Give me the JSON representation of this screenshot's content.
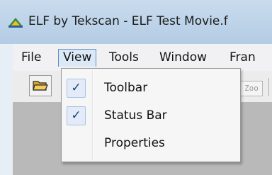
{
  "window": {
    "title": "ELF by Tekscan - ELF Test Movie.f"
  },
  "menubar": {
    "items": [
      {
        "label": "File"
      },
      {
        "label": "View"
      },
      {
        "label": "Tools"
      },
      {
        "label": "Window"
      },
      {
        "label": "Fran"
      }
    ]
  },
  "toolbar": {
    "zoom_label": "Zoo"
  },
  "view_menu": {
    "items": [
      {
        "label": "Toolbar",
        "check": "✓"
      },
      {
        "label": "Status Bar",
        "check": "✓"
      },
      {
        "label": "Properties",
        "check": ""
      }
    ]
  },
  "colors": {
    "titlebar": "#bcd2e8",
    "highlight_border": "#5e8fc6",
    "check_fill": "#e2ebf7"
  },
  "icons": {
    "app": "elf-app-icon",
    "open": "folder-open-icon",
    "check": "checkmark-icon"
  }
}
